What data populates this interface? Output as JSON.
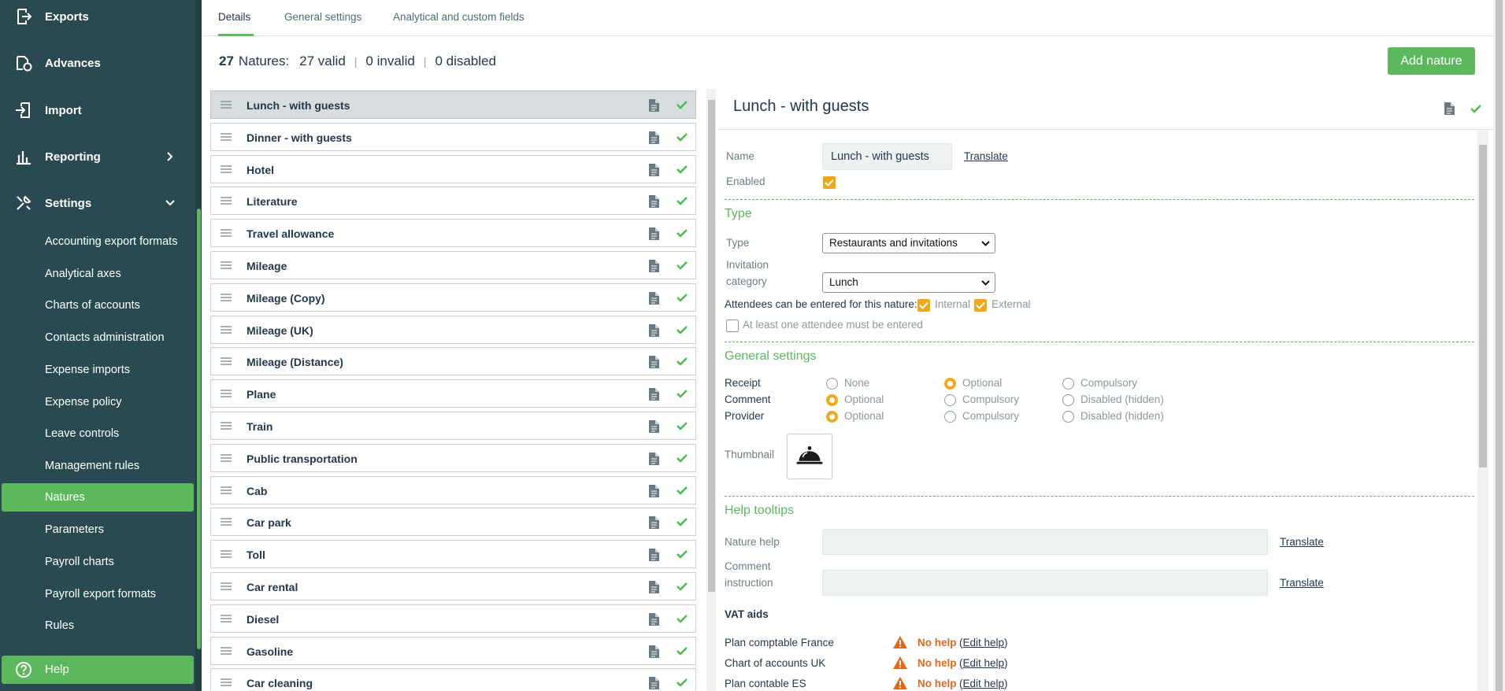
{
  "sidebar": {
    "main_items": [
      {
        "label": "Exports",
        "icon": "export-icon"
      },
      {
        "label": "Advances",
        "icon": "advances-icon"
      },
      {
        "label": "Import",
        "icon": "import-icon"
      },
      {
        "label": "Reporting",
        "icon": "bar-chart-icon"
      },
      {
        "label": "Settings",
        "icon": "tools-icon"
      }
    ],
    "sub_items": [
      "Accounting export formats",
      "Analytical axes",
      "Charts of accounts",
      "Contacts administration",
      "Expense imports",
      "Expense policy",
      "Leave controls",
      "Management rules",
      "Natures",
      "Parameters",
      "Payroll charts",
      "Payroll export formats",
      "Rules"
    ],
    "active_sub": "Natures",
    "help_label": "Help"
  },
  "tabs": [
    "Details",
    "General settings",
    "Analytical and custom fields"
  ],
  "active_tab": "Details",
  "summary": {
    "count": "27",
    "label": "Natures:",
    "valid": "27 valid",
    "invalid": "0 invalid",
    "disabled": "0 disabled"
  },
  "add_button": "Add nature",
  "natures": [
    "Lunch - with guests",
    "Dinner - with guests",
    "Hotel",
    "Literature",
    "Travel allowance",
    "Mileage",
    "Mileage (Copy)",
    "Mileage (UK)",
    "Mileage (Distance)",
    "Plane",
    "Train",
    "Public transportation",
    "Cab",
    "Car park",
    "Toll",
    "Car rental",
    "Diesel",
    "Gasoline",
    "Car cleaning"
  ],
  "selected_nature": "Lunch - with guests",
  "detail": {
    "title": "Lunch - with guests",
    "name_label": "Name",
    "name_value": "Lunch - with guests",
    "translate": "Translate",
    "enabled_label": "Enabled",
    "enabled": true,
    "type_section": "Type",
    "type_label": "Type",
    "type_value": "Restaurants and invitations",
    "invitation_label_1": "Invitation",
    "invitation_label_2": "category",
    "invitation_value": "Lunch",
    "attendees_label": "Attendees can be entered for this nature:",
    "internal_label": "Internal",
    "internal": true,
    "external_label": "External",
    "external": true,
    "at_least_one_label": "At least one attendee must be entered",
    "at_least_one": false,
    "general_section": "General settings",
    "receipt_label": "Receipt",
    "receipt_options": [
      "None",
      "Optional",
      "Compulsory"
    ],
    "receipt_selected": "Optional",
    "comment_label": "Comment",
    "comment_options": [
      "Optional",
      "Compulsory",
      "Disabled (hidden)"
    ],
    "comment_selected": "Optional",
    "provider_label": "Provider",
    "provider_options": [
      "Optional",
      "Compulsory",
      "Disabled (hidden)"
    ],
    "provider_selected": "Optional",
    "thumbnail_label": "Thumbnail",
    "thumbnail_icon": "cloche-icon",
    "help_section": "Help tooltips",
    "nature_help_label": "Nature help",
    "comment_instr_label_1": "Comment",
    "comment_instr_label_2": "instruction",
    "vat_title": "VAT aids",
    "vat_rows": [
      {
        "label": "Plan comptable France",
        "status": "No help",
        "edit": "Edit help"
      },
      {
        "label": "Chart of accounts UK",
        "status": "No help",
        "edit": "Edit help"
      },
      {
        "label": "Plan contable ES",
        "status": "No help",
        "edit": "Edit help"
      }
    ]
  },
  "colors": {
    "sidebar_bg": "#2a4a52",
    "accent_green": "#5cb85c",
    "checkbox_orange": "#f0a818",
    "warning_orange": "#e2671a"
  }
}
